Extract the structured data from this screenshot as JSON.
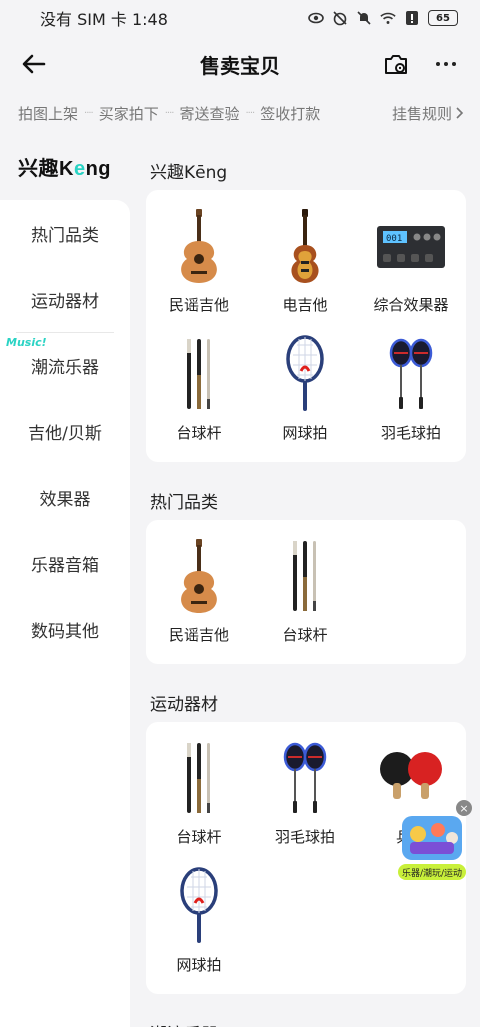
{
  "status_bar": {
    "carrier_time": "没有 SIM 卡 1:48",
    "battery": "65"
  },
  "header": {
    "title": "售卖宝贝"
  },
  "steps": [
    "拍图上架",
    "买家拍下",
    "寄送查验",
    "签收打款"
  ],
  "step_separator": "····",
  "rules_link": "挂售规则",
  "brand": {
    "prefix": "兴趣K",
    "suffix": "ng",
    "middle": "e"
  },
  "sidebar": {
    "items": [
      {
        "label": "热门品类"
      },
      {
        "label": "运动器材"
      },
      {
        "label": "潮流乐器",
        "tag": "Music!"
      },
      {
        "label": "吉他/贝斯"
      },
      {
        "label": "效果器"
      },
      {
        "label": "乐器音箱"
      },
      {
        "label": "数码其他"
      }
    ]
  },
  "sections": [
    {
      "title": "兴趣Kēng",
      "items": [
        {
          "label": "民谣吉他",
          "icon": "acoustic-guitar-icon"
        },
        {
          "label": "电吉他",
          "icon": "electric-guitar-icon"
        },
        {
          "label": "综合效果器",
          "icon": "effects-processor-icon"
        },
        {
          "label": "台球杆",
          "icon": "cue-stick-icon"
        },
        {
          "label": "网球拍",
          "icon": "tennis-racket-icon"
        },
        {
          "label": "羽毛球拍",
          "icon": "badminton-racket-icon"
        }
      ]
    },
    {
      "title": "热门品类",
      "items": [
        {
          "label": "民谣吉他",
          "icon": "acoustic-guitar-icon"
        },
        {
          "label": "台球杆",
          "icon": "cue-stick-icon"
        }
      ]
    },
    {
      "title": "运动器材",
      "items": [
        {
          "label": "台球杆",
          "icon": "cue-stick-icon"
        },
        {
          "label": "羽毛球拍",
          "icon": "badminton-racket-icon"
        },
        {
          "label": "乒乓",
          "icon": "ping-pong-paddle-icon"
        },
        {
          "label": "网球拍",
          "icon": "tennis-racket-icon"
        }
      ]
    },
    {
      "title": "潮流乐器",
      "items": []
    }
  ],
  "promo": {
    "badge": "乐器/潮玩/运动"
  }
}
